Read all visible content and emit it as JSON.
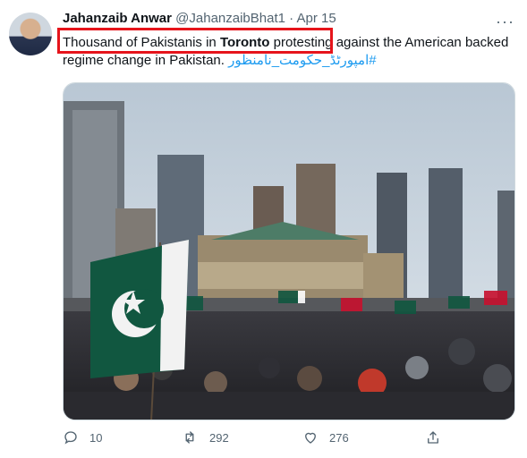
{
  "tweet": {
    "author_name": "Jahanzaib Anwar",
    "handle": "@JahanzaibBhat1",
    "separator": "·",
    "date": "Apr 15",
    "more": "···",
    "text_part1": "Thousand of Pakistanis in ",
    "text_bold": "Toronto",
    "text_part2": " protesting against the American backed regime change in Pakistan. ",
    "hashtag": "#امپورٹڈ_حکومت_نامنظور"
  },
  "actions": {
    "reply_count": "10",
    "retweet_count": "292",
    "like_count": "276"
  },
  "icons": [
    "avatar",
    "more-icon",
    "reply-icon",
    "retweet-icon",
    "like-icon",
    "share-icon"
  ],
  "colors": {
    "highlight_box": "#e6141b",
    "hashtag": "#1d9bf0",
    "secondary_text": "#536471",
    "pakistan_flag_green": "#115740"
  }
}
